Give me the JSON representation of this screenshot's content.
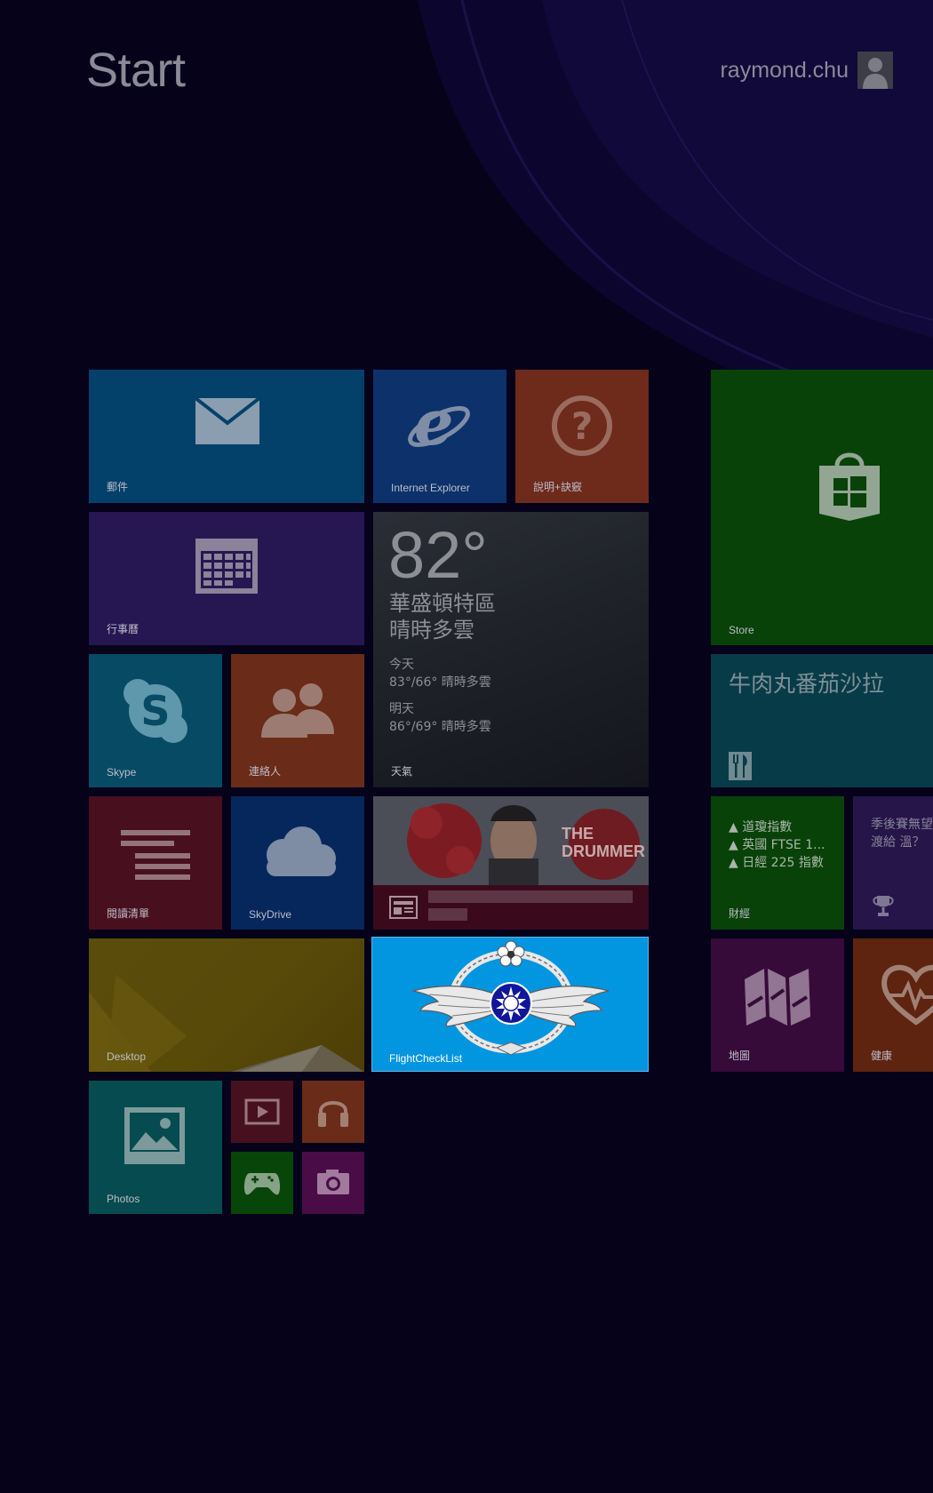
{
  "header": {
    "title": "Start",
    "user_name": "raymond.chu"
  },
  "tiles": {
    "mail": {
      "label": "郵件",
      "icon": "mail-icon"
    },
    "ie": {
      "label": "Internet Explorer",
      "icon": "internet-explorer-icon"
    },
    "help": {
      "label": "說明+訣竅",
      "icon": "help-icon"
    },
    "calendar": {
      "label": "行事曆",
      "icon": "calendar-icon"
    },
    "weather": {
      "label": "天氣",
      "temperature": "82°",
      "location": "華盛頓特區",
      "condition": "晴時多雲",
      "today_label": "今天",
      "today_forecast": "83°/66° 晴時多雲",
      "tomorrow_label": "明天",
      "tomorrow_forecast": "86°/69° 晴時多雲"
    },
    "skype": {
      "label": "Skype",
      "icon": "skype-icon"
    },
    "people": {
      "label": "連絡人",
      "icon": "people-icon"
    },
    "reading": {
      "label": "閱讀清單",
      "icon": "reading-list-icon"
    },
    "skydrive": {
      "label": "SkyDrive",
      "icon": "cloud-icon"
    },
    "news": {
      "icon": "news-icon",
      "photo_text": "THE DRUMMER"
    },
    "desktop": {
      "label": "Desktop"
    },
    "flight": {
      "label": "FlightCheckList",
      "icon": "air-force-emblem-icon"
    },
    "photos": {
      "label": "Photos",
      "icon": "photos-icon"
    },
    "video": {
      "icon": "video-icon"
    },
    "music": {
      "icon": "headphones-icon"
    },
    "games": {
      "icon": "gamepad-icon"
    },
    "camera": {
      "icon": "camera-icon"
    },
    "store": {
      "label": "Store",
      "icon": "store-bag-icon"
    },
    "food": {
      "title": "牛肉丸番茄沙拉",
      "icon": "fork-knife-icon"
    },
    "finance": {
      "label": "財經",
      "lines": [
        "▲ 道瓊指數",
        "▲ 英國 FTSE 1...",
        "▲ 日經 225 指數"
      ]
    },
    "sports": {
      "text": "季後賽無望 修被讓渡給 溫？",
      "icon": "trophy-icon"
    },
    "maps": {
      "label": "地圖",
      "icon": "map-icon"
    },
    "health": {
      "label": "健康",
      "icon": "heart-icon"
    }
  },
  "colors": {
    "background": "#05021a",
    "flight_tile": "#0295e0"
  }
}
